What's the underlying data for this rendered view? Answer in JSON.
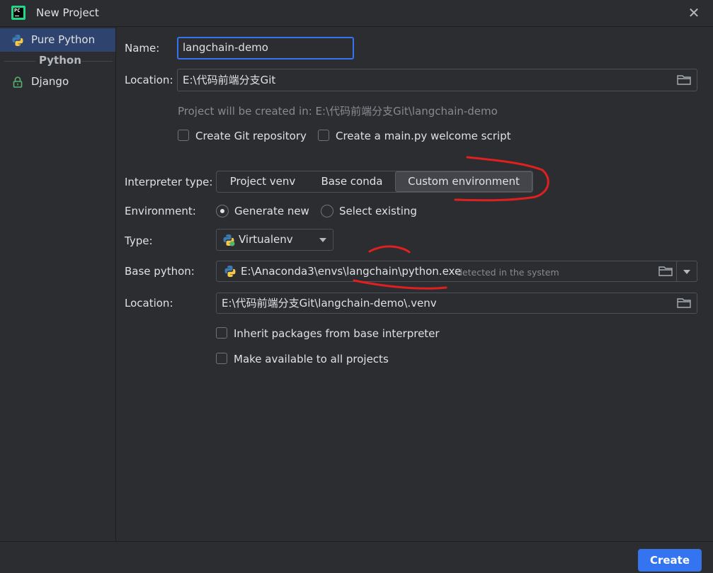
{
  "window": {
    "title": "New Project"
  },
  "sidebar": {
    "items": [
      {
        "label": "Pure Python"
      },
      {
        "label": "Django"
      }
    ],
    "group_label": "Python"
  },
  "form": {
    "name_label": "Name:",
    "name_value": "langchain-demo",
    "location_label": "Location:",
    "location_value": "E:\\代码前端分支Git",
    "project_hint": "Project will be created in: E:\\代码前端分支Git\\langchain-demo",
    "create_git_label": "Create Git repository",
    "create_main_label": "Create a main.py welcome script",
    "interpreter_type_label": "Interpreter type:",
    "interpreter_tabs": [
      "Project venv",
      "Base conda",
      "Custom environment"
    ],
    "interpreter_selected": "Custom environment",
    "environment_label": "Environment:",
    "env_generate_new": "Generate new",
    "env_select_existing": "Select existing",
    "type_label": "Type:",
    "type_value": "Virtualenv",
    "base_python_label": "Base python:",
    "base_python_value": "E:\\Anaconda3\\envs\\langchain\\python.exe",
    "base_python_detected": "detected in the system",
    "venv_location_label": "Location:",
    "venv_location_value": "E:\\代码前端分支Git\\langchain-demo\\.venv",
    "inherit_label": "Inherit packages from base interpreter",
    "make_available_label": "Make available to all projects"
  },
  "footer": {
    "create_label": "Create"
  },
  "colors": {
    "accent": "#3574f0",
    "selection": "#2e436e",
    "background": "#2b2d30",
    "annotation": "#e02020"
  },
  "icons": [
    "pycharm-logo-icon",
    "close-icon",
    "python-icon",
    "lock-icon",
    "folder-icon",
    "chevron-down-icon"
  ]
}
